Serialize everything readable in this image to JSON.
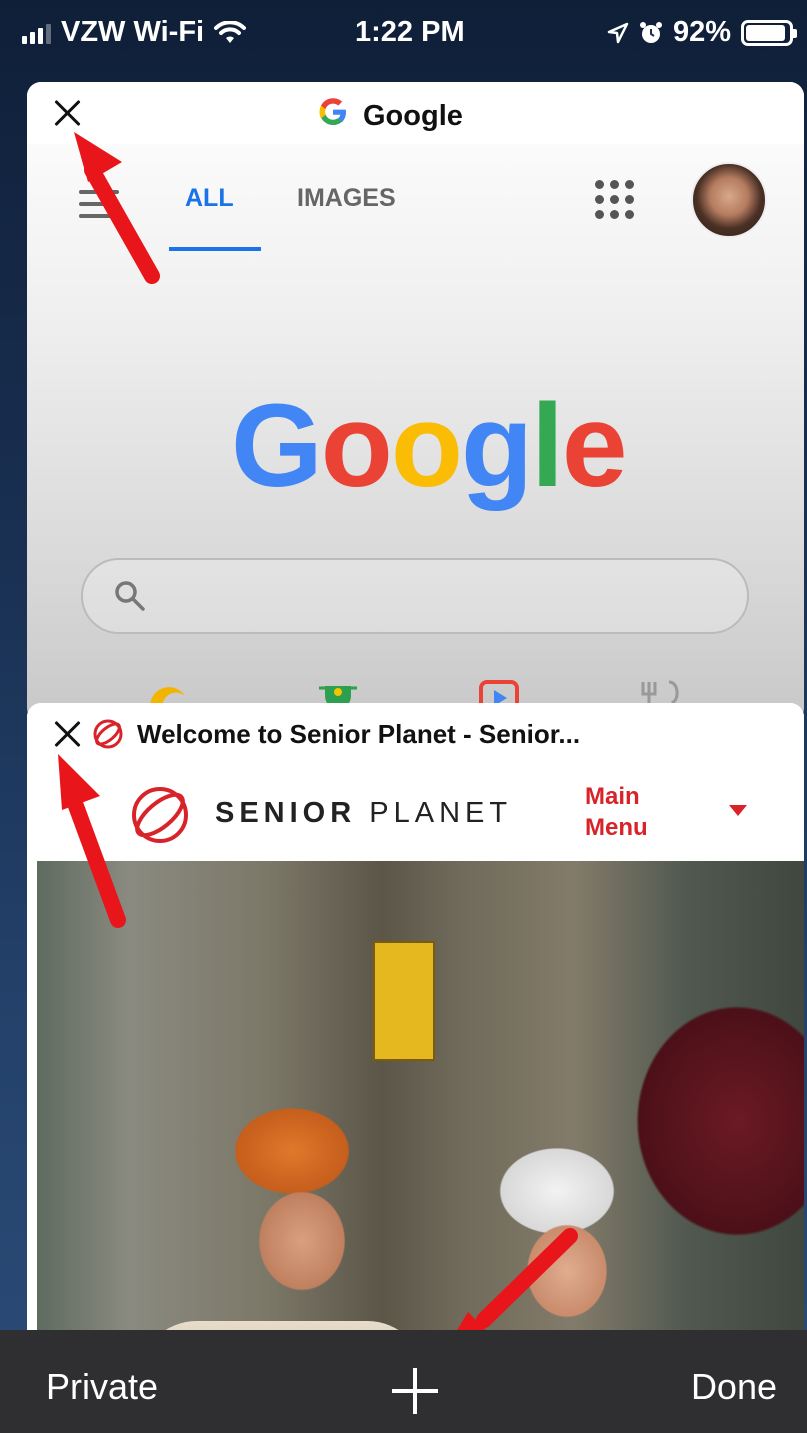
{
  "status_bar": {
    "carrier": "VZW Wi-Fi",
    "time": "1:22 PM",
    "battery": "92%",
    "battery_level": 0.92,
    "icons": [
      "signal-icon",
      "wifi-icon",
      "location-arrow-icon",
      "alarm-icon",
      "battery-icon"
    ]
  },
  "tabs": [
    {
      "title": "Google",
      "favicon": "google-g-icon",
      "page": {
        "nav_all": "ALL",
        "nav_images": "IMAGES",
        "logo_text": "Google",
        "search_placeholder": ""
      }
    },
    {
      "title": "Welcome to Senior Planet - Senior...",
      "favicon": "senior-planet-icon",
      "page": {
        "brand_bold": "SENIOR",
        "brand_light": "PLANET",
        "menu_line1": "Main",
        "menu_line2": "Menu"
      }
    }
  ],
  "toolbar": {
    "private_label": "Private",
    "done_label": "Done",
    "new_tab_icon": "plus-icon"
  },
  "colors": {
    "arrow": "#e8161b",
    "google_blue": "#4285f4",
    "google_red": "#ea4335",
    "google_yellow": "#fbbc05",
    "google_green": "#34a853",
    "senior_planet_red": "#d8232a"
  }
}
